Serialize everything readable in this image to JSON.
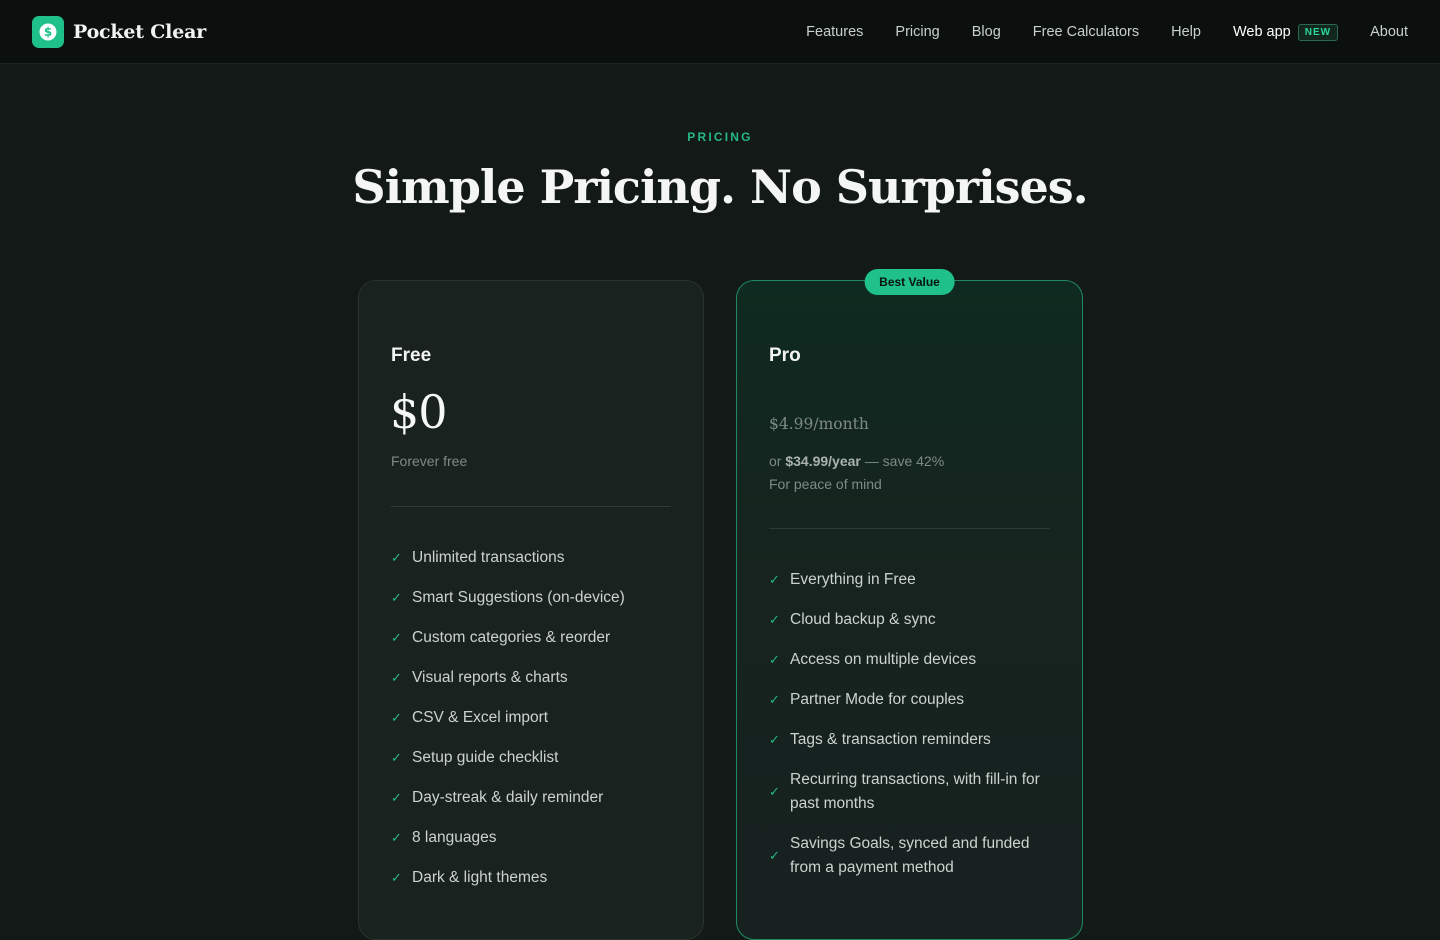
{
  "brand": {
    "name": "Pocket Clear",
    "accent": "#1fc08a",
    "icon": "dollar-coin-icon"
  },
  "nav": [
    {
      "label": "Features"
    },
    {
      "label": "Pricing"
    },
    {
      "label": "Blog"
    },
    {
      "label": "Free Calculators"
    },
    {
      "label": "Help"
    },
    {
      "label": "Web app",
      "badge": "NEW"
    },
    {
      "label": "About"
    }
  ],
  "hero": {
    "eyebrow": "PRICING",
    "title": "Simple Pricing. No Surprises."
  },
  "plans": {
    "free": {
      "name": "Free",
      "price": "$0",
      "subtitle": "Forever free",
      "features": [
        "Unlimited transactions",
        "Smart Suggestions (on-device)",
        "Custom categories & reorder",
        "Visual reports & charts",
        "CSV & Excel import",
        "Setup guide checklist",
        "Day-streak & daily reminder",
        "8 languages",
        "Dark & light themes"
      ]
    },
    "pro": {
      "badge": "Best Value",
      "name": "Pro",
      "price": "$4.99/month",
      "yearly_prefix": "or ",
      "yearly_price": "$34.99/year",
      "yearly_suffix": " — save 42%",
      "tagline": "For peace of mind",
      "features": [
        "Everything in Free",
        "Cloud backup & sync",
        "Access on multiple devices",
        "Partner Mode for couples",
        "Tags & transaction reminders",
        "Recurring transactions, with fill-in for past months",
        "Savings Goals, synced and funded from a payment method"
      ]
    }
  },
  "check_glyph": "✓"
}
